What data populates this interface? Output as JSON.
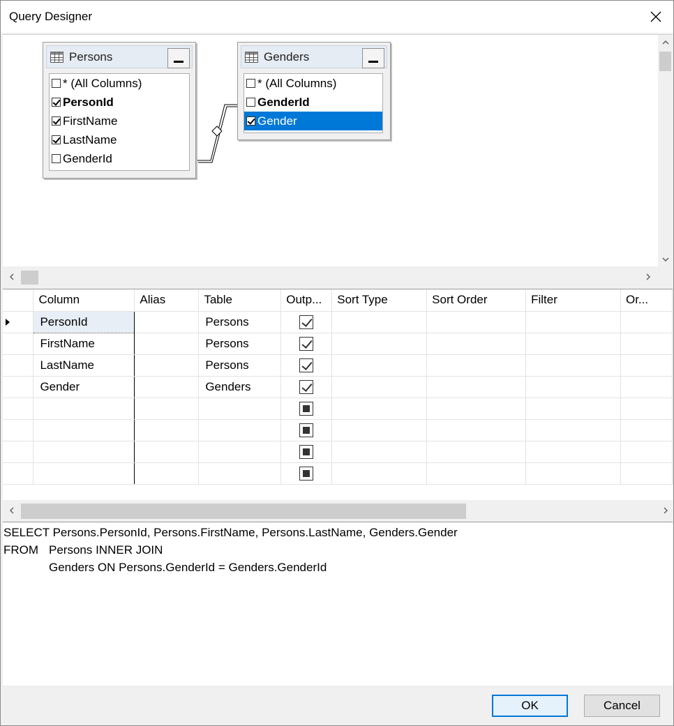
{
  "dialog": {
    "title": "Query Designer",
    "close_glyph": "✕"
  },
  "diagram": {
    "tables": [
      {
        "name": "Persons",
        "columns": [
          {
            "label": "* (All Columns)",
            "checked": false,
            "bold": false,
            "selected": false
          },
          {
            "label": "PersonId",
            "checked": true,
            "bold": true,
            "selected": false
          },
          {
            "label": "FirstName",
            "checked": true,
            "bold": false,
            "selected": false
          },
          {
            "label": "LastName",
            "checked": true,
            "bold": false,
            "selected": false
          },
          {
            "label": "GenderId",
            "checked": false,
            "bold": false,
            "selected": false
          }
        ]
      },
      {
        "name": "Genders",
        "columns": [
          {
            "label": "* (All Columns)",
            "checked": false,
            "bold": false,
            "selected": false
          },
          {
            "label": "GenderId",
            "checked": false,
            "bold": true,
            "selected": false
          },
          {
            "label": "Gender",
            "checked": true,
            "bold": false,
            "selected": true
          }
        ]
      }
    ]
  },
  "grid": {
    "headers": [
      "",
      "Column",
      "Alias",
      "Table",
      "Outp...",
      "Sort Type",
      "Sort Order",
      "Filter",
      "Or..."
    ],
    "rows": [
      {
        "column": "PersonId",
        "alias": "",
        "table": "Persons",
        "output": "checked"
      },
      {
        "column": "FirstName",
        "alias": "",
        "table": "Persons",
        "output": "checked"
      },
      {
        "column": "LastName",
        "alias": "",
        "table": "Persons",
        "output": "checked"
      },
      {
        "column": "Gender",
        "alias": "",
        "table": "Genders",
        "output": "checked"
      },
      {
        "column": "",
        "alias": "",
        "table": "",
        "output": "indeterminate"
      },
      {
        "column": "",
        "alias": "",
        "table": "",
        "output": "indeterminate"
      },
      {
        "column": "",
        "alias": "",
        "table": "",
        "output": "indeterminate"
      },
      {
        "column": "",
        "alias": "",
        "table": "",
        "output": "indeterminate"
      }
    ]
  },
  "sql": {
    "line1_kw": "SELECT",
    "line1_text": "Persons.PersonId, Persons.FirstName, Persons.LastName, Genders.Gender",
    "line2_kw": "FROM",
    "line2_text": "Persons INNER JOIN",
    "line3_text": "Genders ON Persons.GenderId = Genders.GenderId"
  },
  "buttons": {
    "ok": "OK",
    "cancel": "Cancel"
  },
  "colors": {
    "accent": "#0078d7",
    "table_header": "#e6ecf3"
  },
  "icons": [
    "table-grid-icon",
    "minimize-icon",
    "close-icon",
    "scroll-arrow-icon",
    "row-pointer-icon"
  ]
}
